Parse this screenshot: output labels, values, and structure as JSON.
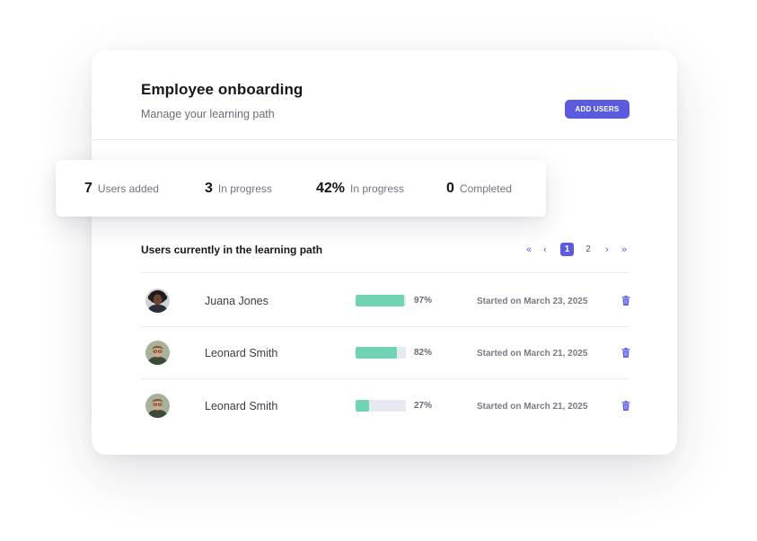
{
  "header": {
    "title": "Employee onboarding",
    "subtitle": "Manage your learning path",
    "add_users_label": "ADD USERS"
  },
  "stats": [
    {
      "value": "7",
      "label": "Users added"
    },
    {
      "value": "3",
      "label": "In progress"
    },
    {
      "value": "42%",
      "label": "In progress"
    },
    {
      "value": "0",
      "label": "Completed"
    }
  ],
  "list": {
    "title": "Users currently in the learning path",
    "pagination": {
      "first": "«",
      "prev": "‹",
      "pages": [
        "1",
        "2"
      ],
      "current": "1",
      "next": "›",
      "last": "»"
    },
    "rows": [
      {
        "name": "Juana Jones",
        "progress": 97,
        "progress_label": "97%",
        "started": "Started on March 23, 2025",
        "avatar_icon": "user-avatar-icon",
        "delete_icon": "trash-icon"
      },
      {
        "name": "Leonard Smith",
        "progress": 82,
        "progress_label": "82%",
        "started": "Started on March 21, 2025",
        "avatar_icon": "user-avatar-icon",
        "delete_icon": "trash-icon"
      },
      {
        "name": "Leonard Smith",
        "progress": 27,
        "progress_label": "27%",
        "started": "Started on March 21, 2025",
        "avatar_icon": "user-avatar-icon",
        "delete_icon": "trash-icon"
      }
    ]
  },
  "colors": {
    "accent": "#5b5be0",
    "progress_fill": "#6fd3b4",
    "progress_track": "#e6e8f2"
  }
}
